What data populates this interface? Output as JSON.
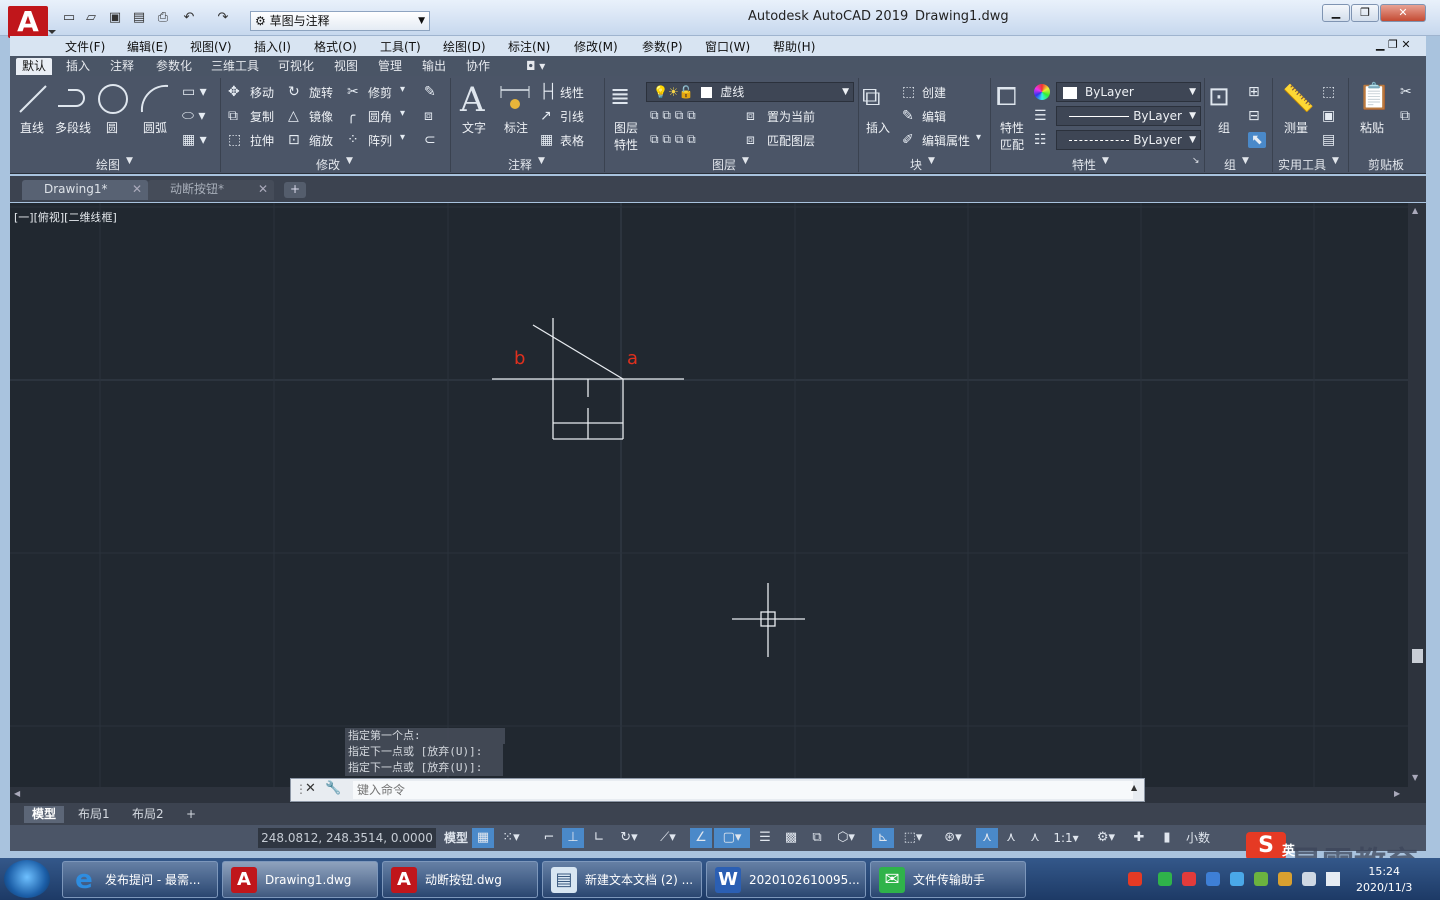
{
  "titlebar": {
    "app_name": "Autodesk AutoCAD 2019",
    "doc_name": "Drawing1.dwg",
    "workspace": "草图与注释"
  },
  "menubar": {
    "items": [
      "文件(F)",
      "编辑(E)",
      "视图(V)",
      "插入(I)",
      "格式(O)",
      "工具(T)",
      "绘图(D)",
      "标注(N)",
      "修改(M)",
      "参数(P)",
      "窗口(W)",
      "帮助(H)"
    ]
  },
  "ribbon": {
    "tabs": [
      "默认",
      "插入",
      "注释",
      "参数化",
      "三维工具",
      "可视化",
      "视图",
      "管理",
      "输出",
      "协作"
    ],
    "active_tab": "默认",
    "draw": {
      "line": "直线",
      "polyline": "多段线",
      "circle": "圆",
      "arc": "圆弧",
      "panel": "绘图"
    },
    "modify": {
      "move": "移动",
      "rotate": "旋转",
      "trim": "修剪",
      "copy": "复制",
      "mirror": "镜像",
      "fillet": "圆角",
      "stretch": "拉伸",
      "scale": "缩放",
      "array": "阵列",
      "panel": "修改"
    },
    "annotation": {
      "text": "文字",
      "dimension": "标注",
      "linear": "线性",
      "leader": "引线",
      "table": "表格",
      "panel": "注释"
    },
    "layers": {
      "properties_line1": "图层",
      "properties_line2": "特性",
      "current_layer": "虚线",
      "make_current": "置为当前",
      "match_layer": "匹配图层",
      "panel": "图层"
    },
    "block": {
      "insert": "插入",
      "create": "创建",
      "edit": "编辑",
      "edit_attributes": "编辑属性",
      "panel": "块"
    },
    "properties": {
      "match_line1": "特性",
      "match_line2": "匹配",
      "color": "ByLayer",
      "lineweight": "ByLayer",
      "linetype": "ByLayer",
      "panel": "特性"
    },
    "groups": {
      "group": "组",
      "panel": "组"
    },
    "utilities": {
      "measure": "测量",
      "panel": "实用工具"
    },
    "clipboard": {
      "paste": "粘贴",
      "panel": "剪贴板"
    }
  },
  "doc_tabs": [
    {
      "label": "Drawing1*",
      "active": true
    },
    {
      "label": "动断按钮*",
      "active": false
    }
  ],
  "canvas": {
    "view_label": "[一][俯视][二维线框]",
    "label_a": "a",
    "label_b": "b",
    "label_color": "#e0301e"
  },
  "command": {
    "history": [
      "指定第一个点:",
      "指定下一点或 [放弃(U)]:",
      "指定下一点或 [放弃(U)]:"
    ],
    "placeholder": "键入命令"
  },
  "layout_tabs": [
    "模型",
    "布局1",
    "布局2"
  ],
  "statusbar": {
    "coords": "248.0812, 248.3514, 0.0000",
    "model": "模型",
    "scale": "1:1",
    "units": "小数"
  },
  "taskbar": {
    "items": [
      {
        "label": "发布提问 - 最需...",
        "icon": "ie-icon"
      },
      {
        "label": "Drawing1.dwg",
        "icon": "autocad-icon"
      },
      {
        "label": "动断按钮.dwg",
        "icon": "autocad-icon"
      },
      {
        "label": "新建文本文档 (2) ...",
        "icon": "notepad-icon"
      },
      {
        "label": "2020102610095...",
        "icon": "word-icon"
      },
      {
        "label": "文件传输助手",
        "icon": "wechat-icon"
      }
    ],
    "ime_label": "英",
    "date": "2020/11/3",
    "time": "15:24",
    "watermark": "最需教育"
  }
}
